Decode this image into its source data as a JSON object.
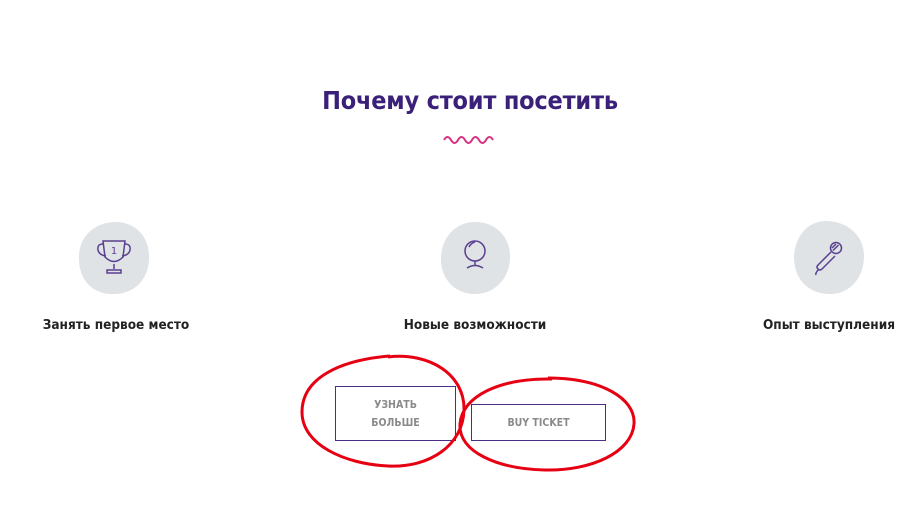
{
  "colors": {
    "title": "#3a2079",
    "accent_wave": "#d6327f",
    "label_text": "#222222",
    "badge_bg": "#dfe3e6",
    "icon_stroke": "#5a3f8f",
    "button_border": "#4a2e86",
    "button_text": "#8a8a8a",
    "annotation_red": "#e60012"
  },
  "section": {
    "title": "Почему стоит посетить"
  },
  "features": [
    {
      "icon": "trophy-icon",
      "label": "Занять первое место"
    },
    {
      "icon": "mirror-icon",
      "label": "Новые возможности"
    },
    {
      "icon": "microphone-icon",
      "label": "Опыт выступления"
    }
  ],
  "buttons": {
    "learn_more_line1": "Узнать",
    "learn_more_line2": "больше",
    "buy_ticket": "Buy ticket"
  }
}
